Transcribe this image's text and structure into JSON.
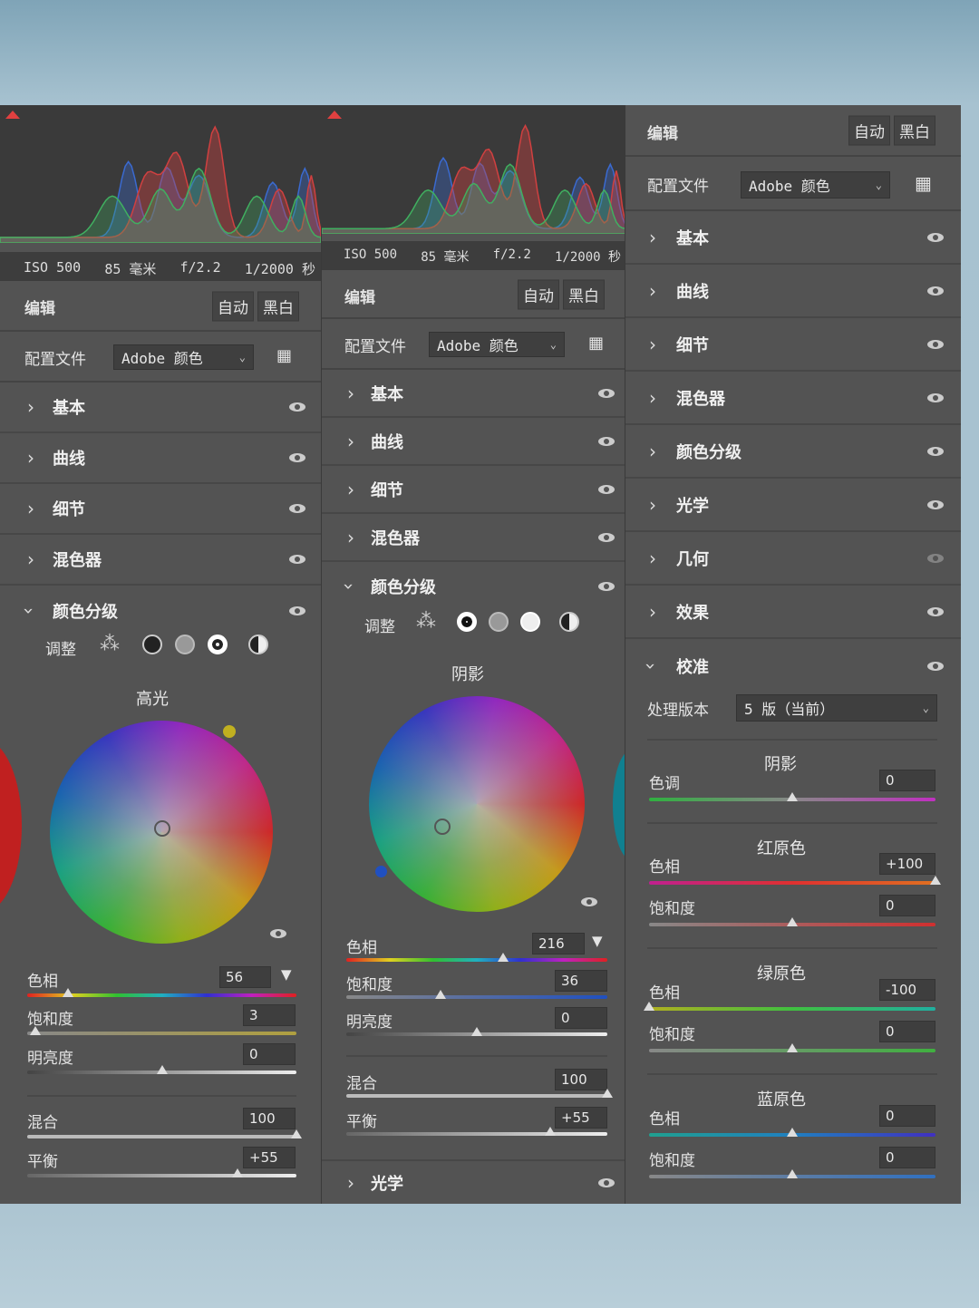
{
  "exif": {
    "iso": "ISO 500",
    "focal": "85 毫米",
    "aperture": "f/2.2",
    "shutter": "1/2000 秒"
  },
  "header": {
    "title": "编辑",
    "auto": "自动",
    "bw": "黑白"
  },
  "profile": {
    "label": "配置文件",
    "value": "Adobe 颜色"
  },
  "sections": {
    "basic": "基本",
    "curve": "曲线",
    "detail": "细节",
    "mixer": "混色器",
    "grading": "颜色分级",
    "optics": "光学",
    "geometry": "几何",
    "effects": "效果",
    "calibration": "校准"
  },
  "p1": {
    "adjust_label": "调整",
    "wheel_title": "高光",
    "hue": {
      "label": "色相",
      "value": "56",
      "fraction": 0.15
    },
    "sat": {
      "label": "饱和度",
      "value": "3",
      "fraction": 0.03
    },
    "lum": {
      "label": "明亮度",
      "value": "0",
      "fraction": 0.5
    },
    "blend": {
      "label": "混合",
      "value": "100",
      "fraction": 1.0
    },
    "balance": {
      "label": "平衡",
      "value": "+55",
      "fraction": 0.78
    }
  },
  "p2": {
    "adjust_label": "调整",
    "wheel_title": "阴影",
    "hue": {
      "label": "色相",
      "value": "216",
      "fraction": 0.6
    },
    "sat": {
      "label": "饱和度",
      "value": "36",
      "fraction": 0.36
    },
    "lum": {
      "label": "明亮度",
      "value": "0",
      "fraction": 0.5
    },
    "blend": {
      "label": "混合",
      "value": "100",
      "fraction": 1.0
    },
    "balance": {
      "label": "平衡",
      "value": "+55",
      "fraction": 0.78
    }
  },
  "p3": {
    "process_label": "处理版本",
    "process_value": "5 版（当前）",
    "shadows": {
      "title": "阴影",
      "tint_label": "色调",
      "tint_value": "0",
      "tint_fraction": 0.5
    },
    "red": {
      "title": "红原色",
      "hue_label": "色相",
      "hue_value": "+100",
      "hue_fraction": 1.0,
      "sat_label": "饱和度",
      "sat_value": "0",
      "sat_fraction": 0.5
    },
    "green": {
      "title": "绿原色",
      "hue_label": "色相",
      "hue_value": "-100",
      "hue_fraction": 0.0,
      "sat_label": "饱和度",
      "sat_value": "0",
      "sat_fraction": 0.5
    },
    "blue": {
      "title": "蓝原色",
      "hue_label": "色相",
      "hue_value": "0",
      "hue_fraction": 0.5,
      "sat_label": "饱和度",
      "sat_value": "0",
      "sat_fraction": 0.5
    }
  }
}
